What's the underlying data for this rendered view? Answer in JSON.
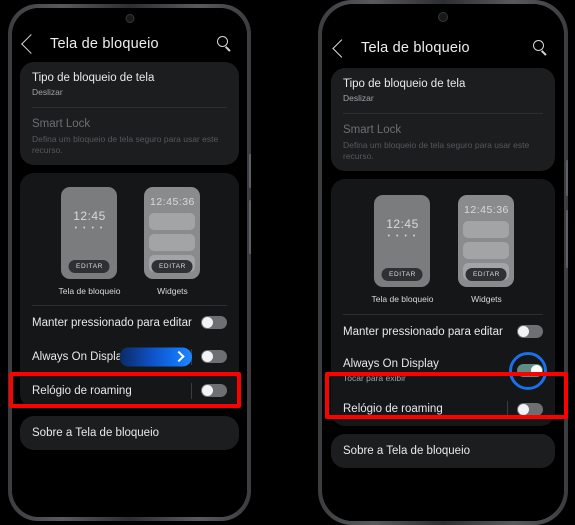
{
  "screen": {
    "header": {
      "back_icon": "back-chevron-icon",
      "title": "Tela de bloqueio",
      "search_icon": "search-icon"
    },
    "lock_card": {
      "lock_type": {
        "title": "Tipo de bloqueio de tela",
        "subtitle": "Deslizar"
      },
      "smart_lock": {
        "title": "Smart Lock",
        "subtitle": "Defina um bloqueio de tela seguro para usar este recurso.",
        "disabled": true
      }
    },
    "previews": {
      "lockscreen": {
        "clock": "12:45",
        "dots": "• • • •",
        "edit_label": "EDITAR",
        "caption": "Tela de bloqueio"
      },
      "widgets": {
        "clock": "12:45:36",
        "edit_label": "EDITAR",
        "caption": "Widgets"
      }
    },
    "settings_card": {
      "hold_to_edit": {
        "title": "Manter pressionado para editar",
        "toggle_state": "off"
      },
      "always_on_display_left": {
        "title": "Always On Display",
        "toggle_state": "off"
      },
      "always_on_display_right": {
        "title": "Always On Display",
        "subtitle": "Tocar para exibir",
        "toggle_state": "on"
      },
      "roaming_clock": {
        "title": "Relógio de roaming",
        "toggle_state": "off"
      }
    },
    "about_card": {
      "title": "Sobre a Tela de bloqueio"
    }
  },
  "annotations": {
    "highlight_color": "#ff0000",
    "callout_blue": "#1b6fe8",
    "arrow_gradient_start": "#0b2a63",
    "arrow_gradient_end": "#1f86ff",
    "toggle_on_color": "#5f8d85",
    "toggle_off_color": "#6d6f72"
  }
}
